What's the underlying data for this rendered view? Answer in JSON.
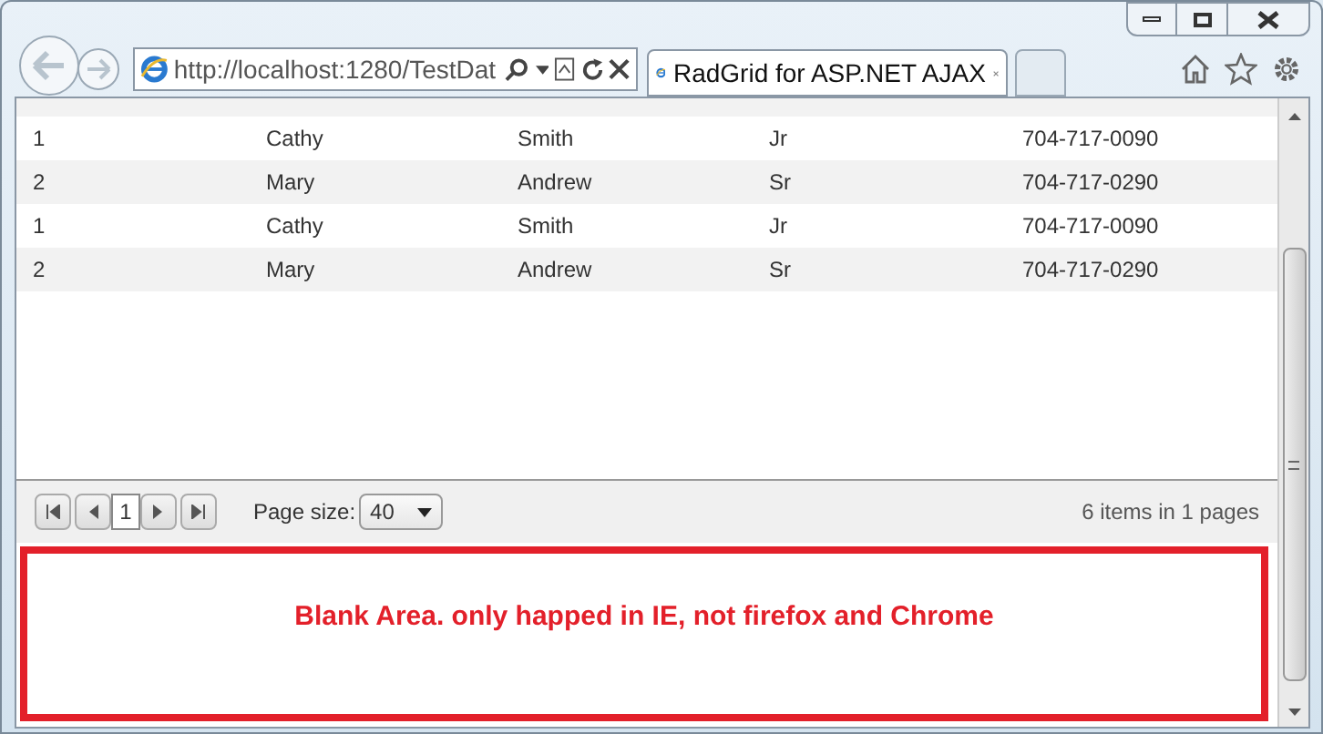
{
  "browser": {
    "address": "http://localhost:1280/TestDat",
    "tabs": [
      {
        "title": "RadGrid for ASP.NET AJAX",
        "selected": true
      }
    ]
  },
  "grid": {
    "rows": [
      {
        "cells": [
          "1",
          "Cathy",
          "Smith",
          "Jr",
          "704-717-0090"
        ]
      },
      {
        "cells": [
          "2",
          "Mary",
          "Andrew",
          "Sr",
          "704-717-0290"
        ]
      },
      {
        "cells": [
          "1",
          "Cathy",
          "Smith",
          "Jr",
          "704-717-0090"
        ]
      },
      {
        "cells": [
          "2",
          "Mary",
          "Andrew",
          "Sr",
          "704-717-0290"
        ]
      }
    ],
    "pager": {
      "current_page": "1",
      "page_size_label": "Page size:",
      "page_size": "40",
      "summary": "6 items in 1 pages"
    }
  },
  "note": "Blank Area. only happed in IE, not firefox and Chrome"
}
